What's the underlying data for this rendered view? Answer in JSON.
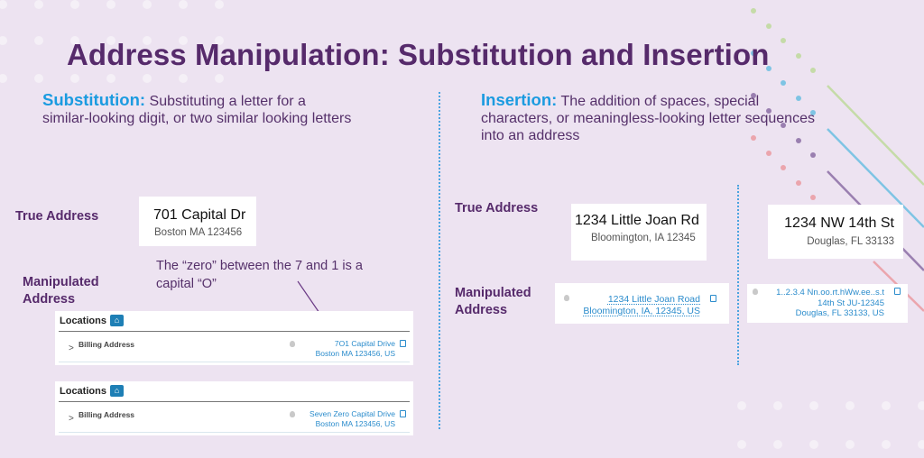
{
  "slide": {
    "title": "Address Manipulation: Substitution and Insertion",
    "colors": {
      "background": "#ede3f1",
      "title": "#562a6b",
      "keyword": "#1b9be0",
      "link": "#2b8ccc",
      "accent_green": "#c5dba8",
      "accent_blue": "#7ec4e4",
      "accent_purple": "#9a7fb0",
      "accent_pink": "#eba5ad"
    }
  },
  "substitution": {
    "keyword": "Substitution:",
    "description_line1": "Substituting a letter for a",
    "description_line2": "similar-looking digit, or two similar looking letters",
    "true_label": "True Address",
    "true_address": {
      "line1": "701 Capital Dr",
      "line2": "Boston MA 123456"
    },
    "manipulated_label_line1": "Manipulated",
    "manipulated_label_line2": "Address",
    "note_line1": "The “zero” between the 7 and 1 is a",
    "note_line2": "capital “O”",
    "examples": [
      {
        "header": "Locations",
        "home_icon": "home-icon",
        "field": "Billing Address",
        "address_line1": "7O1 Capital Drive",
        "address_line2": "Boston MA 123456, US"
      },
      {
        "header": "Locations",
        "home_icon": "home-icon",
        "field": "Billing Address",
        "address_line1": "Seven Zero Capital Drive",
        "address_line2": "Boston MA 123456, US"
      }
    ]
  },
  "insertion": {
    "keyword": "Insertion:",
    "description_line1": "The addition of spaces, special",
    "description_line2": "characters, or meaningless-looking letter sequences",
    "description_line3": "into an address",
    "true_label": "True Address",
    "manipulated_label_line1": "Manipulated",
    "manipulated_label_line2": "Address",
    "examples": [
      {
        "true_line1": "1234 Little Joan Rd",
        "true_line2": "Bloomington, IA 12345",
        "manip_line1": "1234 Little Joan Road",
        "manip_line2": "Bloomington, IA, 12345, US"
      },
      {
        "true_line1": "1234 NW 14th St",
        "true_line2": "Douglas, FL 33133",
        "manip_line1": "1..2.3.4 Nn.oo.rt.hWw.ee..s.t",
        "manip_line2": "14th St JU-12345",
        "manip_line3": "Douglas, FL 33133, US"
      }
    ]
  }
}
